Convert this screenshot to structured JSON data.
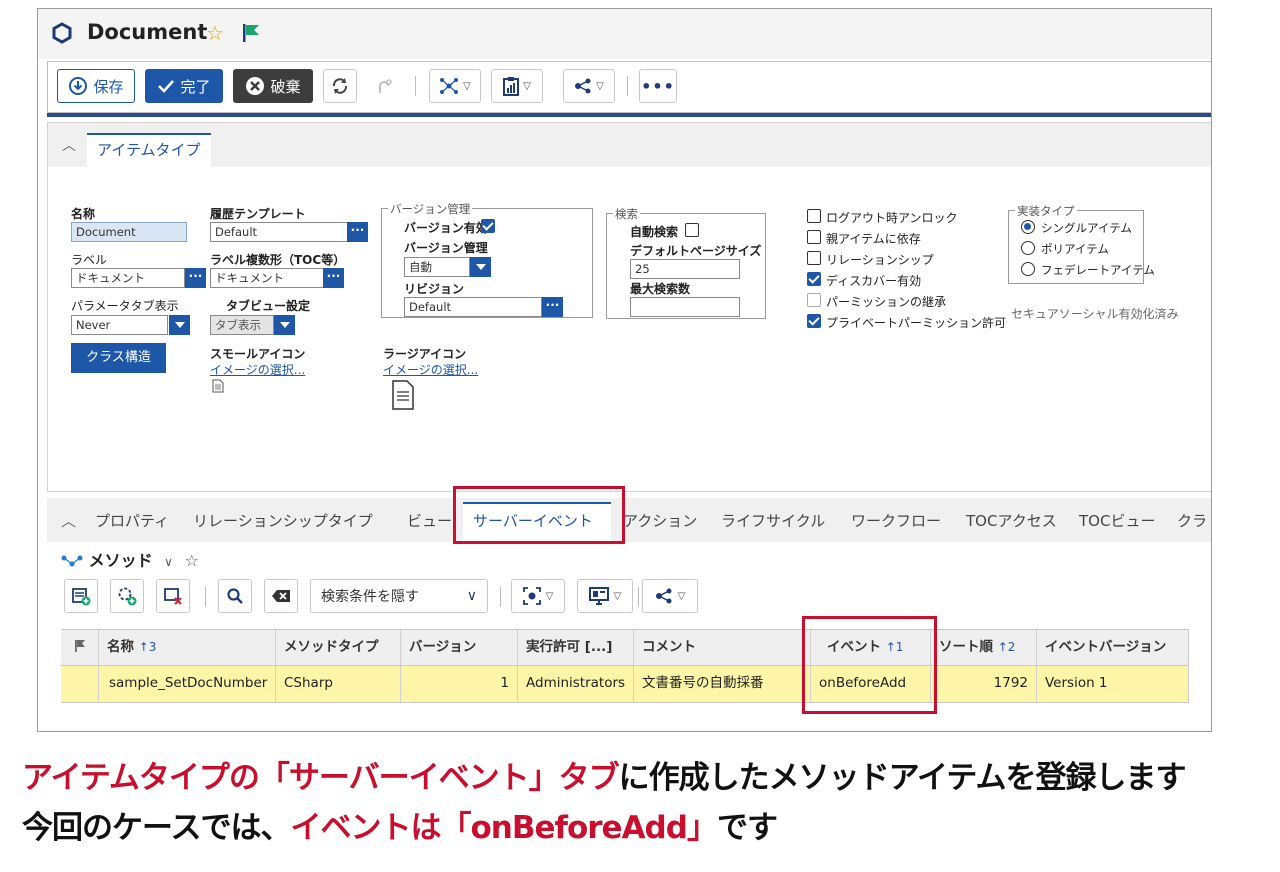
{
  "window": {
    "title": "Document"
  },
  "toolbar": {
    "save": "保存",
    "done": "完了",
    "discard": "破棄"
  },
  "item_tab": "アイテムタイプ",
  "form": {
    "name_label": "名称",
    "name_value": "Document",
    "history_template_label": "履歴テンプレート",
    "history_template_value": "Default",
    "label_label": "ラベル",
    "label_value": "ドキュメント",
    "label_plural_label": "ラベル複数形（TOC等）",
    "label_plural_value": "ドキュメント",
    "param_tab_label": "パラメータタブ表示",
    "param_tab_value": "Never",
    "tabview_label": "タブビュー設定",
    "tabview_value": "タブ表示",
    "class_structure_button": "クラス構造",
    "small_icon_label": "スモールアイコン",
    "small_icon_link": "イメージの選択...",
    "large_icon_label": "ラージアイコン",
    "large_icon_link": "イメージの選択...",
    "version_group": "バージョン管理",
    "version_enabled_label": "バージョン有効",
    "version_control_label": "バージョン管理",
    "version_control_value": "自動",
    "revision_label": "リビジョン",
    "revision_value": "Default",
    "search_group": "検索",
    "auto_search_label": "自動検索",
    "default_page_size_label": "デフォルトページサイズ",
    "default_page_size_value": "25",
    "max_search_label": "最大検索数",
    "max_search_value": "",
    "checks": [
      {
        "label": "ログアウト時アンロック",
        "checked": false,
        "disabled": false
      },
      {
        "label": "親アイテムに依存",
        "checked": false,
        "disabled": false
      },
      {
        "label": "リレーションシップ",
        "checked": false,
        "disabled": false
      },
      {
        "label": "ディスカバー有効",
        "checked": true,
        "disabled": false
      },
      {
        "label": "パーミッションの継承",
        "checked": false,
        "disabled": true
      },
      {
        "label": "プライベートパーミッション許可",
        "checked": true,
        "disabled": false
      }
    ],
    "impl_group": "実装タイプ",
    "impl_options": [
      {
        "label": "シングルアイテム",
        "selected": true
      },
      {
        "label": "ポリアイテム",
        "selected": false
      },
      {
        "label": "フェデレートアイテム",
        "selected": false
      }
    ],
    "secure_social": "セキュアソーシャル有効化済み"
  },
  "relationship_tabs": [
    "プロパティ",
    "リレーションシップタイプ",
    "ビュー",
    "サーバーイベント",
    "アクション",
    "ライフサイクル",
    "ワークフロー",
    "TOCアクセス",
    "TOCビュー",
    "クラ"
  ],
  "active_tab": "サーバーイベント",
  "method_title": "メソッド",
  "search_toggle": "検索条件を隠す",
  "table": {
    "headers": [
      "名称",
      "メソッドタイプ",
      "バージョン",
      "実行許可 [...]",
      "コメント",
      "イベント",
      "ソート順",
      "イベントバージョン"
    ],
    "sort_numbers": {
      "name": "3",
      "event": "1",
      "sort": "2"
    },
    "rows": [
      [
        "sample_SetDocNumber",
        "CSharp",
        "1",
        "Administrators",
        "文書番号の自動採番",
        "onBeforeAdd",
        "1792",
        "Version 1"
      ]
    ]
  },
  "caption": {
    "line1_red": "アイテムタイプの「サーバーイベント」タブ",
    "line1_black": "に作成したメソッドアイテムを登録します",
    "line2_black": "今回のケースでは、",
    "line2_red": "イベントは「onBeforeAdd」",
    "line2_black2": "です"
  },
  "colors": {
    "accent": "#1e57a8",
    "highlight": "#c8102e",
    "row_selected": "#fdf6a8"
  }
}
